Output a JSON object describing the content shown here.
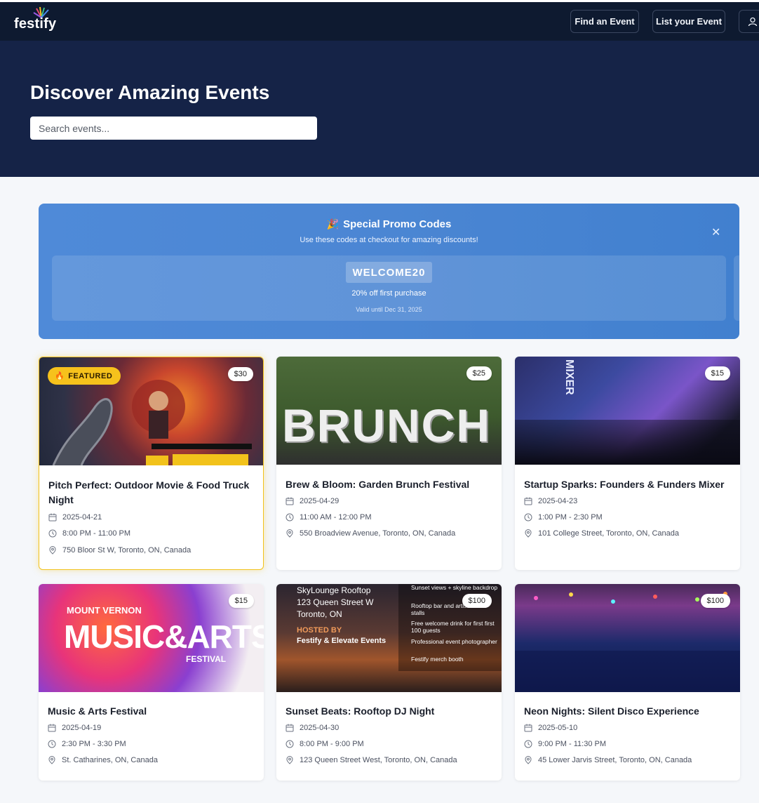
{
  "nav": {
    "logo": "festify",
    "find_label": "Find an Event",
    "list_label": "List your Event",
    "user_icon": "user-icon"
  },
  "hero": {
    "title": "Discover Amazing Events",
    "search_placeholder": "Search events..."
  },
  "promo": {
    "title": "Special Promo Codes",
    "subtitle": "Use these codes at checkout for amazing discounts!",
    "close": "✕",
    "code": "WELCOME20",
    "description": "20% off first purchase",
    "valid": "Valid until Dec 31, 2025"
  },
  "featured_badge": "FEATURED",
  "events": [
    {
      "title": "Pitch Perfect: Outdoor Movie & Food Truck Night",
      "date": "2025-04-21",
      "time": "8:00 PM - 11:00 PM",
      "location": "750 Bloor St W, Toronto, ON, Canada",
      "price": "$30"
    },
    {
      "title": "Brew & Bloom: Garden Brunch Festival",
      "date": "2025-04-29",
      "time": "11:00 AM - 12:00 PM",
      "location": "550 Broadview Avenue, Toronto, ON, Canada",
      "price": "$25",
      "image_text": "BRUNCH"
    },
    {
      "title": "Startup Sparks: Founders & Funders Mixer",
      "date": "2025-04-23",
      "time": "1:00 PM - 2:30 PM",
      "location": "101 College Street, Toronto, ON, Canada",
      "price": "$15",
      "image_text": "MIXER"
    },
    {
      "title": "Music & Arts Festival",
      "date": "2025-04-19",
      "time": "2:30 PM - 3:30 PM",
      "location": "St. Catharines, ON, Canada",
      "price": "$15",
      "image_top": "MOUNT VERNON",
      "image_main": "MUSIC&ARTS",
      "image_bottom": "FESTIVAL"
    },
    {
      "title": "Sunset Beats: Rooftop DJ Night",
      "date": "2025-04-30",
      "time": "8:00 PM - 9:00 PM",
      "location": "123 Queen Street West, Toronto, ON, Canada",
      "price": "$100",
      "image_venue": [
        "SkyLounge Rooftop",
        "123 Queen Street W",
        "Toronto, ON"
      ],
      "image_hosted": "HOSTED BY",
      "image_host": "Festify & Elevate Events",
      "image_bullets": [
        "Sunset views + skyline backdrop",
        "Rooftop bar and artisan food stalls",
        "Free welcome drink for first first 100 guests",
        "Professional event photographer",
        "Festify merch booth"
      ]
    },
    {
      "title": "Neon Nights: Silent Disco Experience",
      "date": "2025-05-10",
      "time": "9:00 PM - 11:30 PM",
      "location": "45 Lower Jarvis Street, Toronto, ON, Canada",
      "price": "$100"
    }
  ],
  "colors": {
    "nav": "#0e1a30",
    "hero": "#152347",
    "promo": "#4b86d3",
    "featured": "#f6c21c"
  }
}
